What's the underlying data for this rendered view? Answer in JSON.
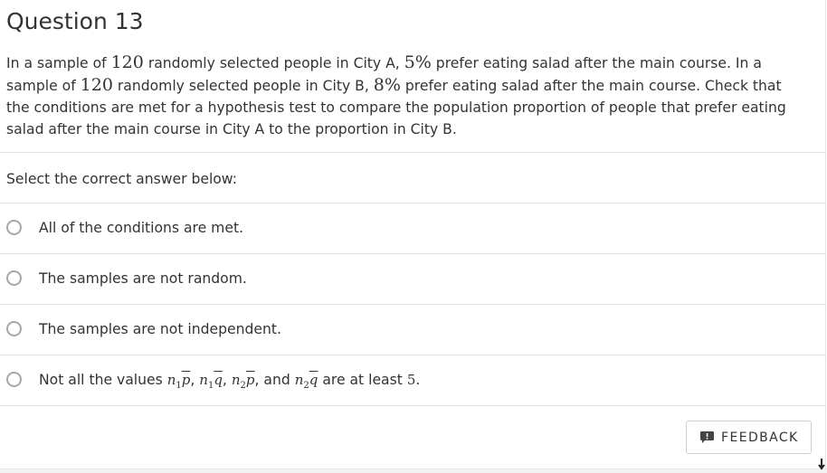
{
  "question": {
    "title": "Question 13",
    "body": {
      "t1": "In a sample of ",
      "n1": "120",
      "t2": " randomly selected people in City A, ",
      "p1": "5%",
      "t3": " prefer eating salad after the main course. In a sample of ",
      "n2": "120",
      "t4": " randomly selected people in City B, ",
      "p2": "8%",
      "t5": " prefer eating salad after the main course. Check that the conditions are met for a hypothesis test to compare the population proportion of people that prefer eating salad after the main course in City A to the proportion in City B."
    }
  },
  "prompt": "Select the correct answer below:",
  "options": [
    {
      "label": "All of the conditions are met."
    },
    {
      "label": "The samples are not random."
    },
    {
      "label": "The samples are not independent."
    },
    {
      "pre": "Not all the values ",
      "n": "n",
      "sub1": "1",
      "sub2": "2",
      "p": "p",
      "q": "q",
      "comma": ", ",
      "and": ", and ",
      "post": " are at least ",
      "five": "5",
      "period": "."
    }
  ],
  "feedback": {
    "label": "FEEDBACK",
    "icon": "comment-alert-icon"
  },
  "colors": {
    "text": "#333333",
    "divider": "#e3e3e3",
    "radio_border": "#a8a8a8",
    "button_border": "#cfcfcf"
  }
}
